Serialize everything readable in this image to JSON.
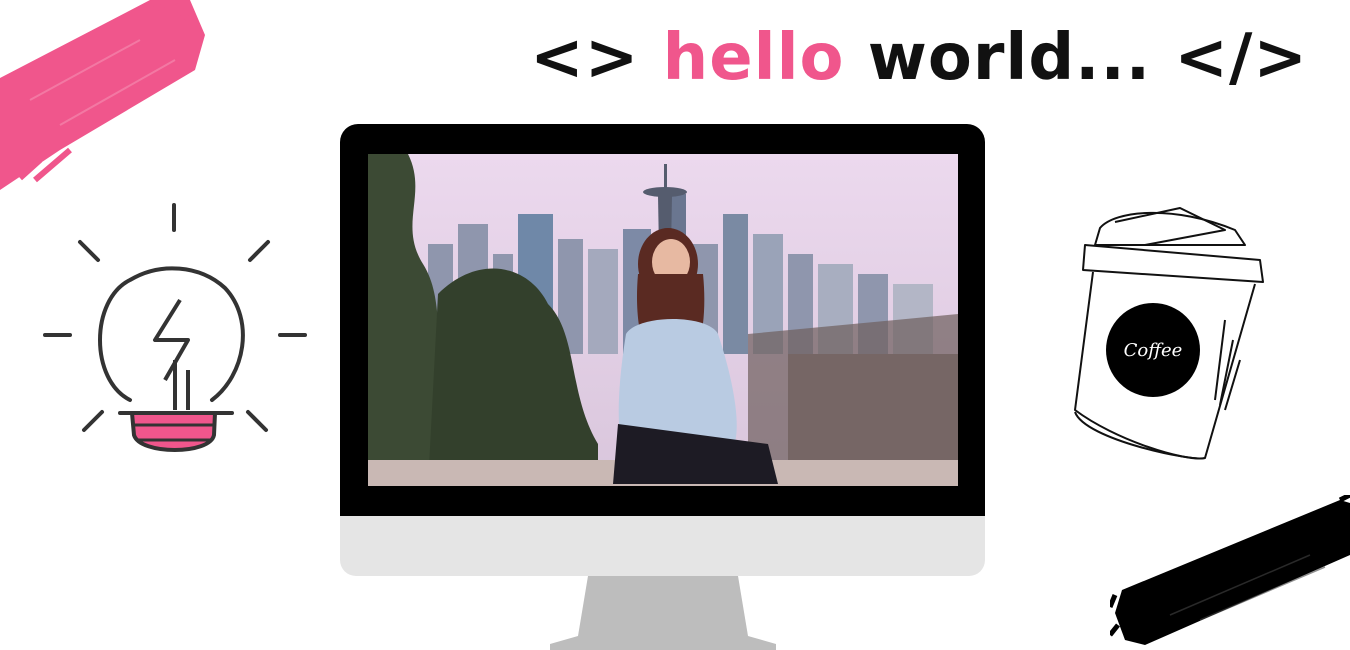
{
  "headline": {
    "prefix": "<> ",
    "highlight": "hello",
    "suffix": " world... </>"
  },
  "colors": {
    "accent_pink": "#f0568c",
    "text_dark": "#111111",
    "monitor_bezel": "#000000",
    "monitor_chin": "#e5e5e5",
    "monitor_stand": "#bdbdbd"
  },
  "coffee_cup": {
    "label": "Coffee"
  },
  "icons": [
    "lightbulb-icon",
    "coffee-cup-icon",
    "pink-brush-stroke",
    "black-brush-stroke"
  ],
  "monitor": {
    "screen_content": "photo"
  }
}
